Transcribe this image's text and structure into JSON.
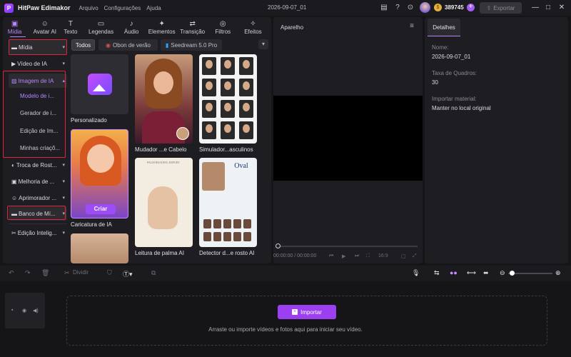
{
  "app": {
    "name": "HitPaw Edimakor",
    "logo_glyph": "P",
    "menu": [
      "Arquivo",
      "Configurações",
      "Ajuda"
    ],
    "doc_title": "2026-09-07_01",
    "credits": "389745",
    "export_label": "Exportar",
    "accent": "#9c3ff0"
  },
  "toolbar": {
    "tabs": [
      {
        "label": "Mídia",
        "icon": "media-icon"
      },
      {
        "label": "Avatar AI",
        "icon": "avatar-ai-icon"
      },
      {
        "label": "Texto",
        "icon": "text-icon"
      },
      {
        "label": "Legendas",
        "icon": "subtitles-icon"
      },
      {
        "label": "Áudio",
        "icon": "audio-icon"
      },
      {
        "label": "Elementos",
        "icon": "elements-icon"
      },
      {
        "label": "Transição",
        "icon": "transition-icon"
      },
      {
        "label": "Filtros",
        "icon": "filters-icon"
      },
      {
        "label": "Efeitos",
        "icon": "effects-icon"
      }
    ],
    "active": "Mídia"
  },
  "sidebar": {
    "items": [
      {
        "label": "Mídia"
      },
      {
        "label": "Vídeo de IA"
      },
      {
        "label": "Imagem de IA"
      },
      {
        "label": "Troca de Rost..."
      },
      {
        "label": "Melhoria de ..."
      },
      {
        "label": "Aprimorador ..."
      },
      {
        "label": "Banco de Mí..."
      },
      {
        "label": "Edição Intelig..."
      }
    ],
    "subitems": [
      {
        "label": "Modelo de i..."
      },
      {
        "label": "Gerador de i..."
      },
      {
        "label": "Edição de Im..."
      },
      {
        "label": "Minhas criaçõ..."
      }
    ]
  },
  "filters": {
    "chips": [
      "Todos",
      "Obon de verão",
      "Seedream 5.0 Pro"
    ],
    "selected": "Todos"
  },
  "cards": [
    {
      "label": "Personalizado"
    },
    {
      "label": "Mudador ...e Cabelo"
    },
    {
      "label": "Simulador...asculinos"
    },
    {
      "label": "Caricatura de IA",
      "action": "Criar"
    },
    {
      "label": "Leitura de palma AI"
    },
    {
      "label": "Detector d...e rosto AI"
    }
  ],
  "thumb_text": {
    "palm_title": "PALM READING REPORT",
    "oval": "Oval"
  },
  "preview": {
    "title": "Aparelho",
    "time": "00:00:00 / 00:00:00",
    "ratio": "16:9"
  },
  "details": {
    "tab": "Detalhes",
    "name_label": "Nome:",
    "name_value": "2026-09-07_01",
    "fps_label": "Taxa de Quadros:",
    "fps_value": "30",
    "import_label": "Importar material:",
    "import_value": "Manter no local original"
  },
  "timeline": {
    "split_label": "Dividir",
    "import_button": "Importar",
    "hint": "Arraste ou importe vídeos e fotos aqui para iniciar seu vídeo."
  }
}
